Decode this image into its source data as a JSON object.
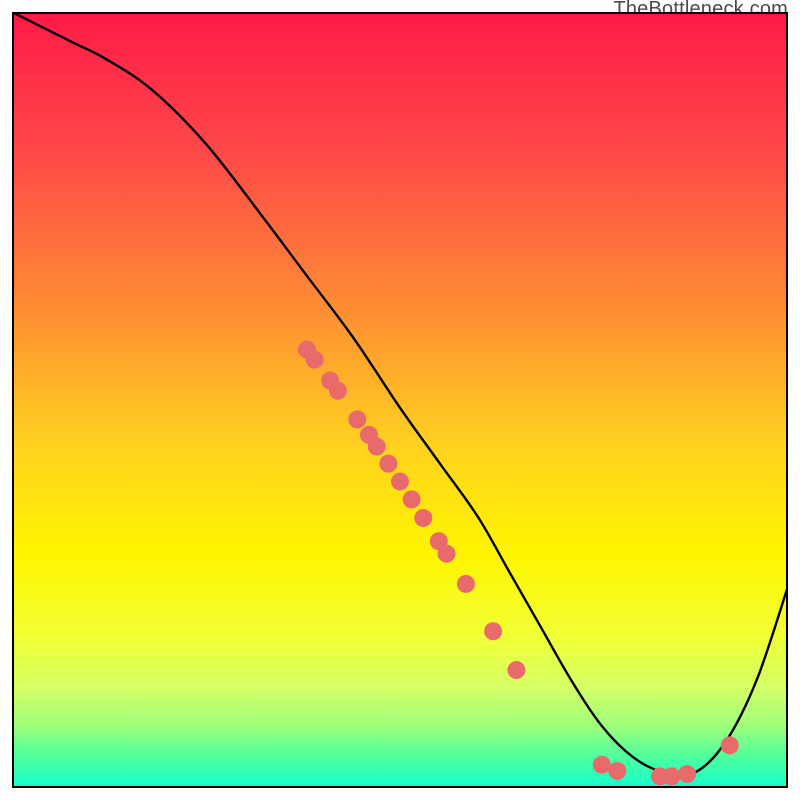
{
  "watermark": "TheBottleneck.com",
  "chart_data": {
    "type": "line",
    "title": "",
    "xlabel": "",
    "ylabel": "",
    "xlim": [
      0,
      100
    ],
    "ylim": [
      0,
      100
    ],
    "grid": false,
    "legend": false,
    "annotations": [],
    "series": [
      {
        "name": "curve",
        "color": "#000000",
        "x": [
          0,
          4,
          8,
          12,
          18,
          25,
          32,
          38,
          44,
          50,
          55,
          60,
          64,
          68,
          72,
          76,
          80,
          84,
          88,
          92,
          96,
          100
        ],
        "y": [
          100,
          98,
          96,
          94,
          90,
          83,
          74,
          66,
          58,
          49,
          42,
          35,
          28,
          21,
          14,
          8,
          4,
          2,
          2,
          6,
          14,
          26
        ]
      }
    ],
    "markers": [
      {
        "x": 38.0,
        "y": 56.5
      },
      {
        "x": 39.0,
        "y": 55.2
      },
      {
        "x": 41.0,
        "y": 52.5
      },
      {
        "x": 42.0,
        "y": 51.2
      },
      {
        "x": 44.5,
        "y": 47.5
      },
      {
        "x": 46.0,
        "y": 45.5
      },
      {
        "x": 47.0,
        "y": 44.0
      },
      {
        "x": 48.5,
        "y": 41.8
      },
      {
        "x": 50.0,
        "y": 39.5
      },
      {
        "x": 51.5,
        "y": 37.2
      },
      {
        "x": 53.0,
        "y": 34.8
      },
      {
        "x": 55.0,
        "y": 31.8
      },
      {
        "x": 56.0,
        "y": 30.2
      },
      {
        "x": 58.5,
        "y": 26.3
      },
      {
        "x": 62.0,
        "y": 20.2
      },
      {
        "x": 65.0,
        "y": 15.2
      },
      {
        "x": 76.0,
        "y": 3.0
      },
      {
        "x": 78.0,
        "y": 2.2
      },
      {
        "x": 83.5,
        "y": 1.5
      },
      {
        "x": 85.0,
        "y": 1.5
      },
      {
        "x": 87.0,
        "y": 1.8
      },
      {
        "x": 92.5,
        "y": 5.5
      }
    ],
    "background_gradient": {
      "direction": "vertical",
      "stops": [
        {
          "pos": 0.0,
          "color": "#ff1a48"
        },
        {
          "pos": 0.18,
          "color": "#ff4848"
        },
        {
          "pos": 0.38,
          "color": "#ff8c33"
        },
        {
          "pos": 0.56,
          "color": "#ffd21f"
        },
        {
          "pos": 0.7,
          "color": "#fff500"
        },
        {
          "pos": 0.8,
          "color": "#f2ff33"
        },
        {
          "pos": 0.87,
          "color": "#d5ff66"
        },
        {
          "pos": 0.92,
          "color": "#9eff7a"
        },
        {
          "pos": 0.96,
          "color": "#4dff9e"
        },
        {
          "pos": 1.0,
          "color": "#14ffd0"
        }
      ]
    },
    "marker_style": {
      "color": "#e86a6a",
      "radius": 9
    }
  }
}
